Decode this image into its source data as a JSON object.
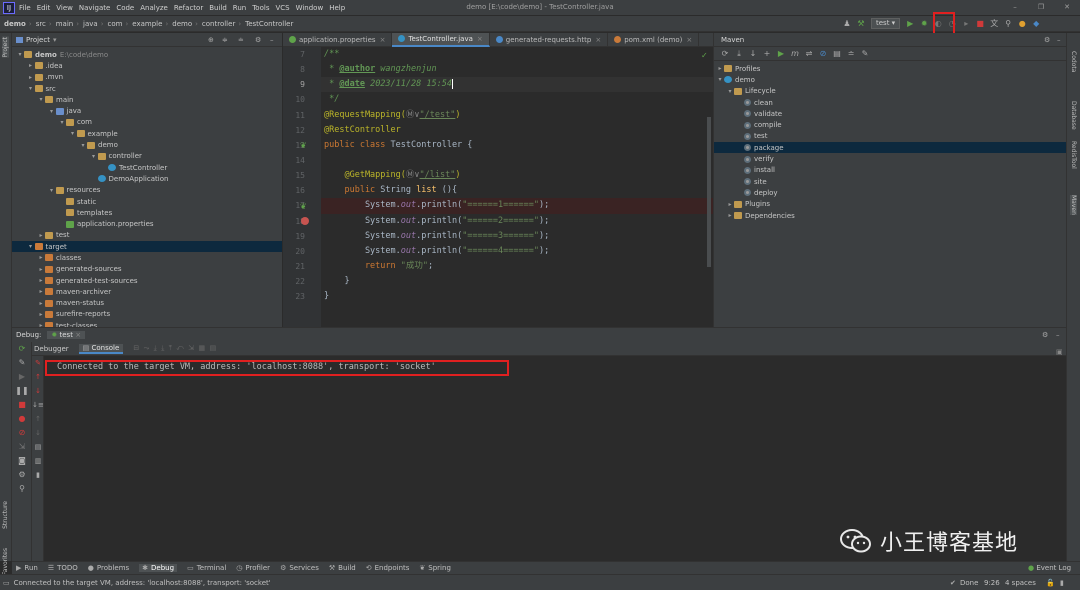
{
  "window": {
    "title": "demo [E:\\code\\demo] - TestController.java"
  },
  "menu": [
    "File",
    "Edit",
    "View",
    "Navigate",
    "Code",
    "Analyze",
    "Refactor",
    "Build",
    "Run",
    "Tools",
    "VCS",
    "Window",
    "Help"
  ],
  "breadcrumb": [
    "demo",
    "src",
    "main",
    "java",
    "com",
    "example",
    "demo",
    "controller",
    "TestController"
  ],
  "toolbar": {
    "run_config": "test"
  },
  "left_strip": {
    "project": "Project",
    "structure": "Structure",
    "favorites": "Favorites"
  },
  "right_strip": {
    "codota": "Codota",
    "database": "Database",
    "redis": "RedisTool",
    "maven": "Maven"
  },
  "project": {
    "title": "Project",
    "tree": [
      {
        "label": "demo",
        "path": "E:\\code\\demo",
        "depth": 0,
        "arrow": "▾",
        "icon": "folder",
        "bold": true
      },
      {
        "label": ".idea",
        "depth": 1,
        "arrow": "▸",
        "icon": "folder"
      },
      {
        "label": ".mvn",
        "depth": 1,
        "arrow": "▸",
        "icon": "folder"
      },
      {
        "label": "src",
        "depth": 1,
        "arrow": "▾",
        "icon": "folder"
      },
      {
        "label": "main",
        "depth": 2,
        "arrow": "▾",
        "icon": "folder"
      },
      {
        "label": "java",
        "depth": 3,
        "arrow": "▾",
        "icon": "folder blue"
      },
      {
        "label": "com",
        "depth": 4,
        "arrow": "▾",
        "icon": "folder"
      },
      {
        "label": "example",
        "depth": 5,
        "arrow": "▾",
        "icon": "folder"
      },
      {
        "label": "demo",
        "depth": 6,
        "arrow": "▾",
        "icon": "folder"
      },
      {
        "label": "controller",
        "depth": 7,
        "arrow": "▾",
        "icon": "folder"
      },
      {
        "label": "TestController",
        "depth": 8,
        "arrow": "",
        "icon": "cls"
      },
      {
        "label": "DemoApplication",
        "depth": 7,
        "arrow": "",
        "icon": "cls"
      },
      {
        "label": "resources",
        "depth": 3,
        "arrow": "▾",
        "icon": "folder"
      },
      {
        "label": "static",
        "depth": 4,
        "arrow": "",
        "icon": "folder"
      },
      {
        "label": "templates",
        "depth": 4,
        "arrow": "",
        "icon": "folder"
      },
      {
        "label": "application.properties",
        "depth": 4,
        "arrow": "",
        "icon": "prop"
      },
      {
        "label": "test",
        "depth": 2,
        "arrow": "▸",
        "icon": "folder"
      },
      {
        "label": "target",
        "depth": 1,
        "arrow": "▾",
        "icon": "folder orange",
        "selected": true
      },
      {
        "label": "classes",
        "depth": 2,
        "arrow": "▸",
        "icon": "folder orange"
      },
      {
        "label": "generated-sources",
        "depth": 2,
        "arrow": "▸",
        "icon": "folder orange"
      },
      {
        "label": "generated-test-sources",
        "depth": 2,
        "arrow": "▸",
        "icon": "folder orange"
      },
      {
        "label": "maven-archiver",
        "depth": 2,
        "arrow": "▸",
        "icon": "folder orange"
      },
      {
        "label": "maven-status",
        "depth": 2,
        "arrow": "▸",
        "icon": "folder orange"
      },
      {
        "label": "surefire-reports",
        "depth": 2,
        "arrow": "▸",
        "icon": "folder orange"
      },
      {
        "label": "test-classes",
        "depth": 2,
        "arrow": "▸",
        "icon": "folder orange"
      }
    ]
  },
  "editor": {
    "tabs": [
      {
        "label": "application.properties",
        "color": "#5fa34a",
        "active": false
      },
      {
        "label": "TestController.java",
        "color": "#3592c4",
        "active": true
      },
      {
        "label": "generated-requests.http",
        "color": "#4a88c7",
        "active": false
      },
      {
        "label": "pom.xml (demo)",
        "color": "#c97a3a",
        "active": false
      }
    ],
    "line_numbers": [
      "7",
      "8",
      "9",
      "10",
      "11",
      "12",
      "13",
      "14",
      "15",
      "16",
      "17",
      "18",
      "19",
      "20",
      "21",
      "22",
      "23"
    ],
    "code": {
      "l7": "/**",
      "l8_pre": " * ",
      "l8_tag": "@author",
      "l8_val": " wangzhenjun",
      "l9_pre": " * ",
      "l9_tag": "@date",
      "l9_val": " 2023/11/28 15:54",
      "l10": " */",
      "l11_ann": "@RequestMapping(",
      "l11_icon": "Ⓜ∨",
      "l11_str": "\"/test\"",
      "l11_end": ")",
      "l12_ann": "@RestController",
      "l13_kw": "public class ",
      "l13_rest": "TestController {",
      "l15_ann": "    @GetMapping(",
      "l15_icon": "Ⓜ∨",
      "l15_str": "\"/list\"",
      "l15_end": ")",
      "l16_kw": "    public ",
      "l16_type": "String ",
      "l16_m": "list",
      "l16_end": " (){",
      "l17_a": "        System.",
      "l17_f": "out",
      "l17_b": ".println(",
      "l17_s": "\"======1======\"",
      "l17_e": ");",
      "l18_a": "        System.",
      "l18_f": "out",
      "l18_b": ".println(",
      "l18_s": "\"======2======\"",
      "l18_e": ");",
      "l19_a": "        System.",
      "l19_f": "out",
      "l19_b": ".println(",
      "l19_s": "\"======3======\"",
      "l19_e": ");",
      "l20_a": "        System.",
      "l20_f": "out",
      "l20_b": ".println(",
      "l20_s": "\"======4======\"",
      "l20_e": ");",
      "l21_kw": "        return ",
      "l21_s": "\"成功\"",
      "l21_e": ";",
      "l22": "    }",
      "l23": "}"
    }
  },
  "maven": {
    "title": "Maven",
    "tree": [
      {
        "label": "Profiles",
        "depth": 0,
        "arrow": "▸",
        "icon": "folder"
      },
      {
        "label": "demo",
        "depth": 0,
        "arrow": "▾",
        "icon": "cls"
      },
      {
        "label": "Lifecycle",
        "depth": 1,
        "arrow": "▾",
        "icon": "folder"
      },
      {
        "label": "clean",
        "depth": 2,
        "arrow": "",
        "icon": "gear"
      },
      {
        "label": "validate",
        "depth": 2,
        "arrow": "",
        "icon": "gear"
      },
      {
        "label": "compile",
        "depth": 2,
        "arrow": "",
        "icon": "gear"
      },
      {
        "label": "test",
        "depth": 2,
        "arrow": "",
        "icon": "gear"
      },
      {
        "label": "package",
        "depth": 2,
        "arrow": "",
        "icon": "gear",
        "selected": true
      },
      {
        "label": "verify",
        "depth": 2,
        "arrow": "",
        "icon": "gear"
      },
      {
        "label": "install",
        "depth": 2,
        "arrow": "",
        "icon": "gear"
      },
      {
        "label": "site",
        "depth": 2,
        "arrow": "",
        "icon": "gear"
      },
      {
        "label": "deploy",
        "depth": 2,
        "arrow": "",
        "icon": "gear"
      },
      {
        "label": "Plugins",
        "depth": 1,
        "arrow": "▸",
        "icon": "folder"
      },
      {
        "label": "Dependencies",
        "depth": 1,
        "arrow": "▸",
        "icon": "folder"
      }
    ]
  },
  "debug": {
    "label": "Debug:",
    "config": "test",
    "tabs": {
      "debugger": "Debugger",
      "console": "Console"
    },
    "console_line": "Connected to the target VM, address: 'localhost:8088', transport: 'socket'"
  },
  "bottom_tabs": [
    {
      "label": "Run",
      "icon": "▶"
    },
    {
      "label": "TODO",
      "icon": "☰"
    },
    {
      "label": "Problems",
      "icon": "●"
    },
    {
      "label": "Debug",
      "icon": "✱",
      "active": true
    },
    {
      "label": "Terminal",
      "icon": "▭"
    },
    {
      "label": "Profiler",
      "icon": "◷"
    },
    {
      "label": "Services",
      "icon": "⚙"
    },
    {
      "label": "Build",
      "icon": "⚒"
    },
    {
      "label": "Endpoints",
      "icon": "⟲"
    },
    {
      "label": "Spring",
      "icon": "❦"
    }
  ],
  "event_log": "Event Log",
  "status": {
    "message": "Connected to the target VM, address: 'localhost:8088', transport: 'socket'",
    "done": "Done",
    "position": "9:26",
    "indent": "4 spaces"
  },
  "watermark": {
    "text": "小王博客基地"
  },
  "colors": {
    "highlight_box": "#e02020",
    "accent": "#4a88c7"
  }
}
